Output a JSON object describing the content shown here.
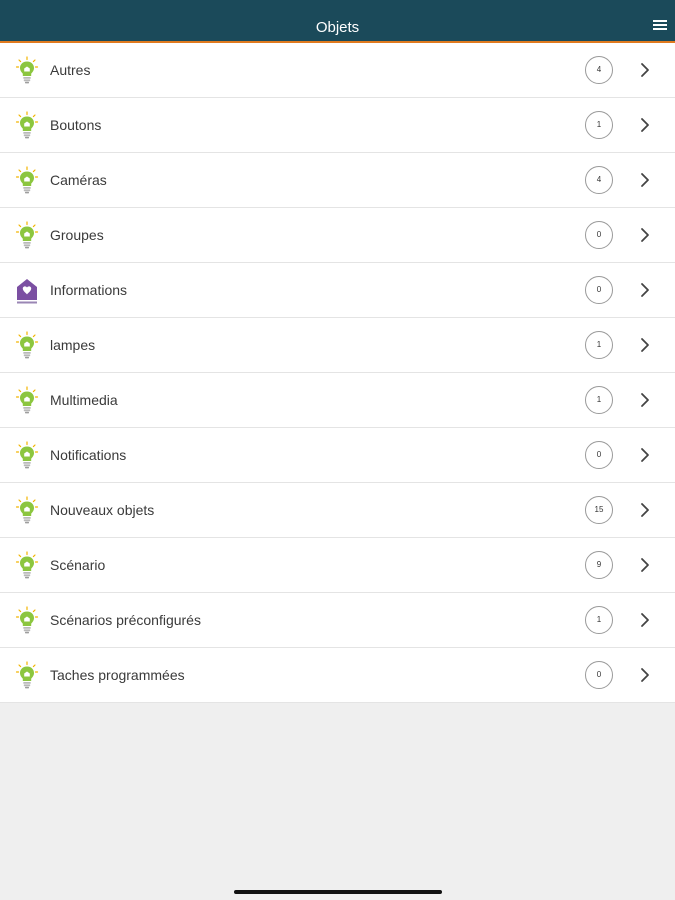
{
  "header": {
    "title": "Objets",
    "menu_icon": "hamburger-menu-icon"
  },
  "colors": {
    "header_bg": "#1b4a5a",
    "header_accent": "#e07a1f",
    "bulb_green": "#8cc63f",
    "info_purple": "#7b4fa2"
  },
  "items": [
    {
      "label": "Autres",
      "count": "4",
      "icon": "lightbulb-icon"
    },
    {
      "label": "Boutons",
      "count": "1",
      "icon": "lightbulb-icon"
    },
    {
      "label": "Caméras",
      "count": "4",
      "icon": "lightbulb-icon"
    },
    {
      "label": "Groupes",
      "count": "0",
      "icon": "lightbulb-icon"
    },
    {
      "label": "Informations",
      "count": "0",
      "icon": "house-heart-icon"
    },
    {
      "label": "lampes",
      "count": "1",
      "icon": "lightbulb-icon"
    },
    {
      "label": "Multimedia",
      "count": "1",
      "icon": "lightbulb-icon"
    },
    {
      "label": "Notifications",
      "count": "0",
      "icon": "lightbulb-icon"
    },
    {
      "label": "Nouveaux objets",
      "count": "15",
      "icon": "lightbulb-icon"
    },
    {
      "label": "Scénario",
      "count": "9",
      "icon": "lightbulb-icon"
    },
    {
      "label": "Scénarios préconfigurés",
      "count": "1",
      "icon": "lightbulb-icon"
    },
    {
      "label": "Taches programmées",
      "count": "0",
      "icon": "lightbulb-icon"
    }
  ]
}
